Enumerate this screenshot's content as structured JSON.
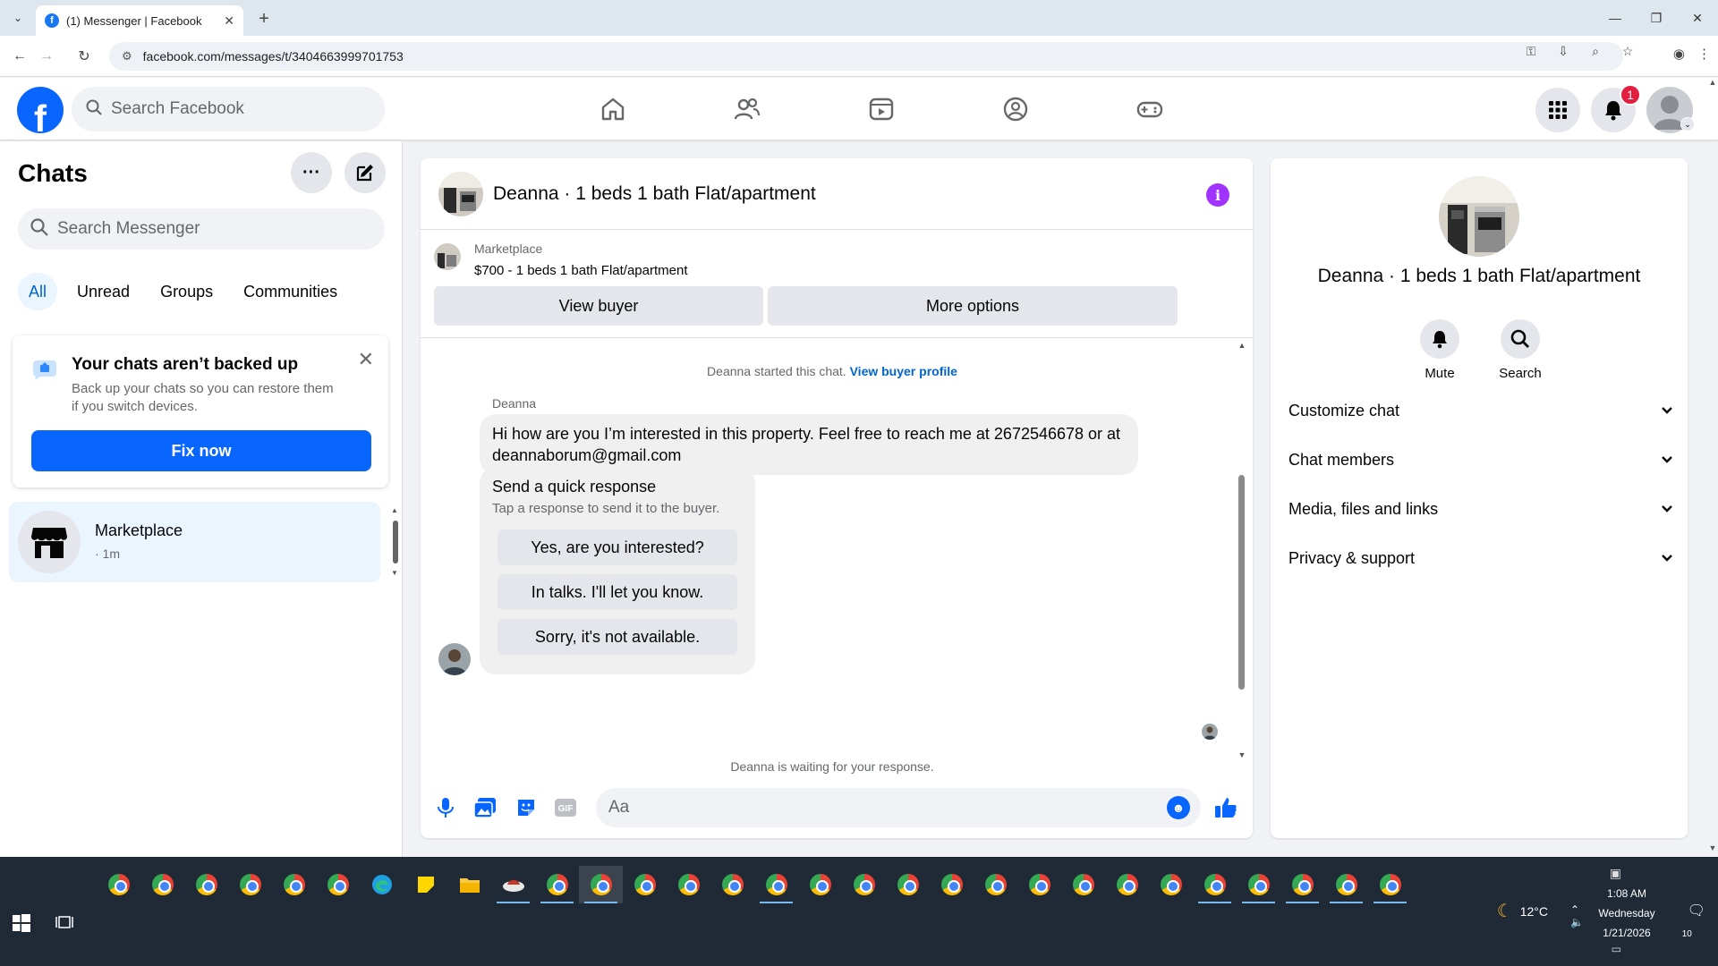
{
  "browser": {
    "tab_title": "(1) Messenger | Facebook",
    "url": "facebook.com/messages/t/3404663999701753"
  },
  "fb": {
    "search_placeholder": "Search Facebook",
    "notification_count": "1",
    "nav_icons": [
      "home-icon",
      "friends-icon",
      "video-icon",
      "groups-icon",
      "gaming-icon"
    ]
  },
  "sidebar": {
    "title": "Chats",
    "search_placeholder": "Search Messenger",
    "filters": [
      "All",
      "Unread",
      "Groups",
      "Communities"
    ],
    "backup": {
      "title": "Your chats aren’t backed up",
      "text": "Back up your chats so you can restore them if you switch devices.",
      "button": "Fix now"
    },
    "chat": {
      "name": "Marketplace",
      "meta": "· 1m"
    }
  },
  "conversation": {
    "title": "Deanna · 1 beds 1 bath Flat/apartment",
    "marketplace_label": "Marketplace",
    "listing": "$700 - 1 beds 1 bath Flat/apartment",
    "view_buyer": "View buyer",
    "more_options": "More options",
    "started_text": "Deanna started this chat.",
    "started_link": "View buyer profile",
    "sender": "Deanna",
    "message": "Hi how are you I’m interested in this property. Feel free to reach me at 2672546678 or at deannaborum@gmail.com",
    "quick_title": "Send a quick response",
    "quick_sub": "Tap a response to send it to the buyer.",
    "quick_options": [
      "Yes, are you interested?",
      "In talks. I'll let you know.",
      "Sorry, it's not available."
    ],
    "waiting": "Deanna is waiting for your response.",
    "composer_placeholder": "Aa"
  },
  "details": {
    "title": "Deanna · 1 beds 1 bath Flat/apartment",
    "mute": "Mute",
    "search": "Search",
    "sections": [
      "Customize chat",
      "Chat members",
      "Media, files and links",
      "Privacy & support"
    ]
  },
  "taskbar": {
    "weather": "12°C",
    "time": "1:08 AM",
    "day": "Wednesday",
    "date": "1/21/2026",
    "notification_count": "10"
  },
  "colors": {
    "fb_blue": "#0866ff",
    "link_blue": "#0064d1",
    "info_purple": "#a033ff",
    "badge_red": "#e41e3f"
  }
}
